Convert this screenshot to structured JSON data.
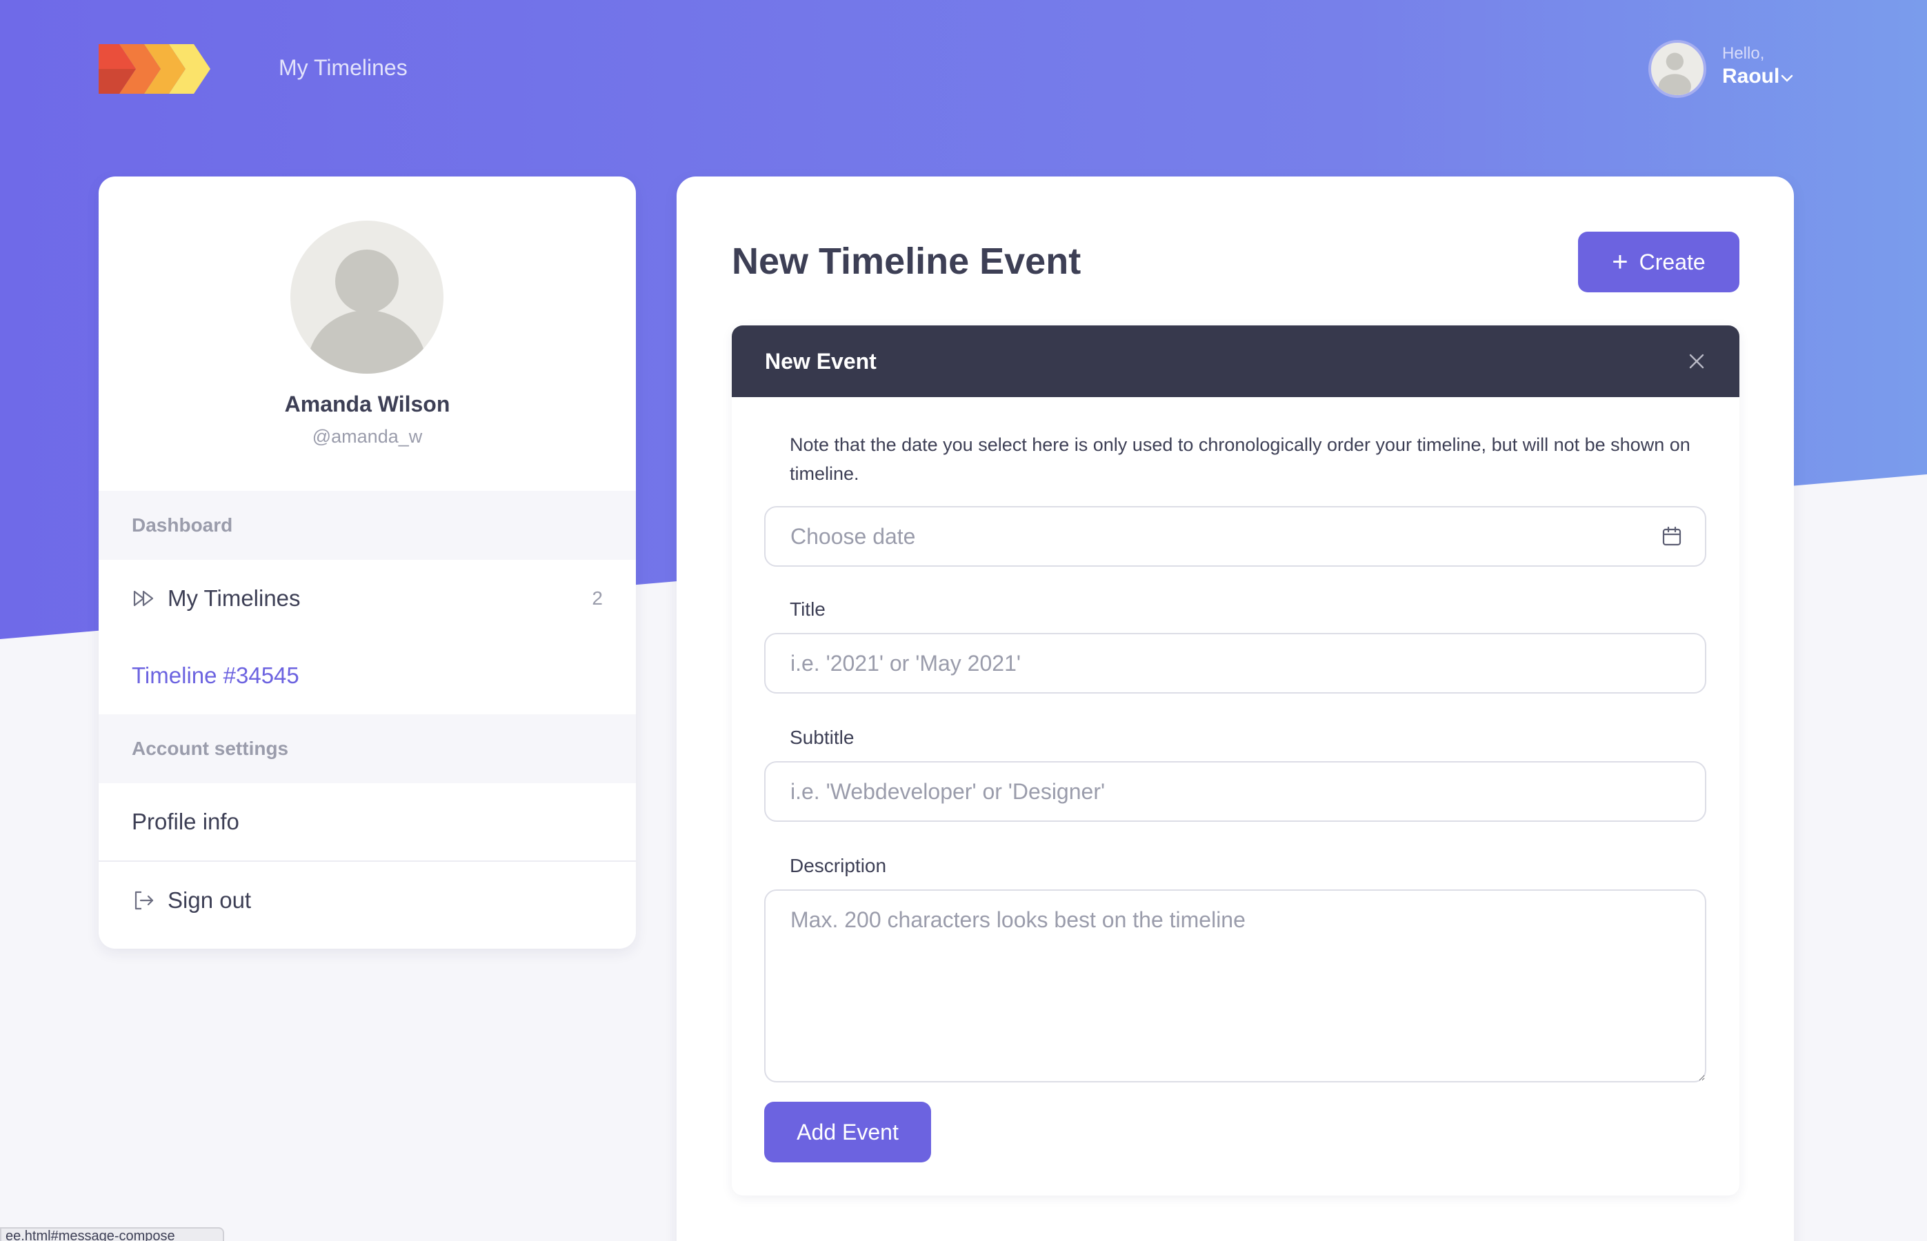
{
  "header": {
    "nav_link": "My Timelines",
    "greeting": "Hello,",
    "user_name": "Raoul"
  },
  "profile": {
    "name": "Amanda Wilson",
    "handle": "@amanda_w"
  },
  "sidebar": {
    "section_dashboard": "Dashboard",
    "my_timelines_label": "My Timelines",
    "my_timelines_count": "2",
    "timeline_item": "Timeline #34545",
    "section_account": "Account settings",
    "profile_info": "Profile info",
    "sign_out": "Sign out"
  },
  "main": {
    "title": "New Timeline Event",
    "create_label": "Create",
    "panel_title": "New Event",
    "note": "Note that the date you select here is only used to chronologically order your timeline, but will not be shown on timeline.",
    "date_placeholder": "Choose date",
    "title_label": "Title",
    "title_placeholder": "i.e. '2021' or 'May 2021'",
    "subtitle_label": "Subtitle",
    "subtitle_placeholder": "i.e. 'Webdeveloper' or 'Designer'",
    "description_label": "Description",
    "description_placeholder": "Max. 200 characters looks best on the timeline",
    "add_button": "Add Event"
  },
  "status_bar": {
    "url": "ee.html#message-compose"
  },
  "colors": {
    "accent": "#6c63e0",
    "panel_header": "#37394d",
    "gradient_start": "#6f6ae8",
    "gradient_end": "#7a9cec"
  }
}
